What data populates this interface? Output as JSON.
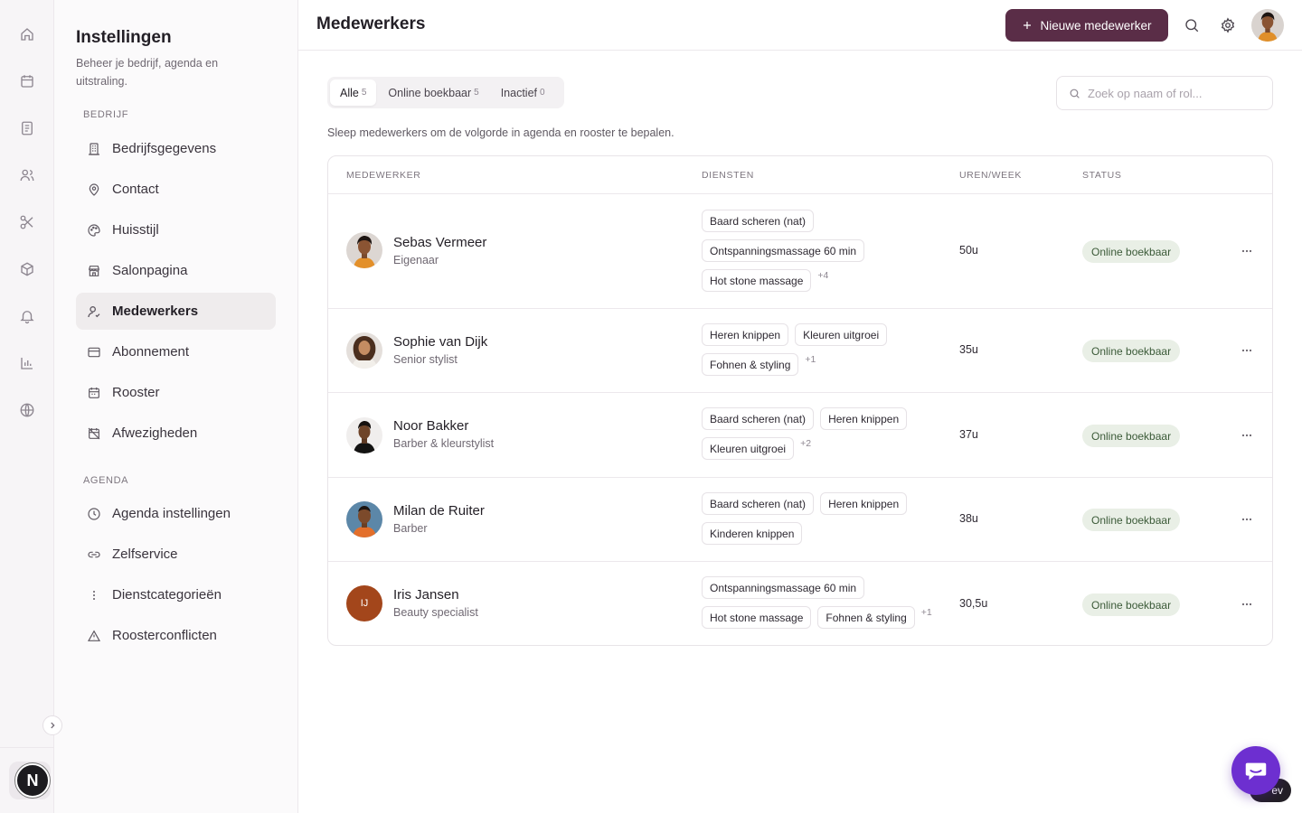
{
  "sidebar": {
    "title": "Instellingen",
    "subtitle": "Beheer je bedrijf, agenda en uitstraling.",
    "sections": [
      {
        "label": "BEDRIJF"
      },
      {
        "label": "AGENDA"
      }
    ],
    "items": [
      {
        "label": "Bedrijfsgegevens",
        "icon": "building-icon"
      },
      {
        "label": "Contact",
        "icon": "location-pin-icon"
      },
      {
        "label": "Huisstijl",
        "icon": "palette-icon"
      },
      {
        "label": "Salonpagina",
        "icon": "storefront-icon"
      },
      {
        "label": "Medewerkers",
        "icon": "user-icon",
        "active": true
      },
      {
        "label": "Abonnement",
        "icon": "credit-card-icon"
      },
      {
        "label": "Rooster",
        "icon": "calendar-icon"
      },
      {
        "label": "Afwezigheden",
        "icon": "calendar-off-icon"
      },
      {
        "label": "Agenda instellingen",
        "icon": "clock-icon"
      },
      {
        "label": "Zelfservice",
        "icon": "link-icon"
      },
      {
        "label": "Dienstcategorieën",
        "icon": "drag-handle-icon"
      },
      {
        "label": "Roosterconflicten",
        "icon": "warning-icon"
      }
    ]
  },
  "rail": {
    "icons": [
      "home-icon",
      "calendar-icon",
      "document-icon",
      "users-icon",
      "scissors-icon",
      "package-icon",
      "bell-icon",
      "bar-chart-icon",
      "globe-icon"
    ],
    "logo_letter": "N"
  },
  "header": {
    "title": "Medewerkers",
    "new_button": "Nieuwe medewerker"
  },
  "tabs": [
    {
      "label": "Alle",
      "count": "5"
    },
    {
      "label": "Online boekbaar",
      "count": "5"
    },
    {
      "label": "Inactief",
      "count": "0"
    }
  ],
  "search": {
    "placeholder": "Zoek op naam of rol..."
  },
  "hint": "Sleep medewerkers om de volgorde in agenda en rooster te bepalen.",
  "table": {
    "columns": [
      "MEDEWERKER",
      "DIENSTEN",
      "UREN/WEEK",
      "STATUS"
    ],
    "rows": [
      {
        "name": "Sebas Vermeer",
        "role": "Eigenaar",
        "hours": "50u",
        "status": "Online boekbaar",
        "more": "+4",
        "services": [
          "Baard scheren (nat)",
          "Ontspanningsmassage 60 min",
          "Hot stone massage"
        ]
      },
      {
        "name": "Sophie van Dijk",
        "role": "Senior stylist",
        "hours": "35u",
        "status": "Online boekbaar",
        "more": "+1",
        "services": [
          "Heren knippen",
          "Kleuren uitgroei",
          "Fohnen & styling"
        ]
      },
      {
        "name": "Noor Bakker",
        "role": "Barber & kleurstylist",
        "hours": "37u",
        "status": "Online boekbaar",
        "more": "+2",
        "services": [
          "Baard scheren (nat)",
          "Heren knippen",
          "Kleuren uitgroei"
        ]
      },
      {
        "name": "Milan de Ruiter",
        "role": "Barber",
        "hours": "38u",
        "status": "Online boekbaar",
        "more": "",
        "services": [
          "Baard scheren (nat)",
          "Heren knippen",
          "Kinderen knippen"
        ]
      },
      {
        "name": "Iris Jansen",
        "role": "Beauty specialist",
        "hours": "30,5u",
        "status": "Online boekbaar",
        "more": "+1",
        "initials": "IJ",
        "services": [
          "Ontspanningsmassage 60 min",
          "Hot stone massage",
          "Fohnen & styling"
        ]
      }
    ]
  },
  "dev_pill": "ev",
  "colors": {
    "primary": "#5a2d47",
    "status_bg": "#e9efe6",
    "status_text": "#3b5a38",
    "chat": "#6d2fd0"
  }
}
